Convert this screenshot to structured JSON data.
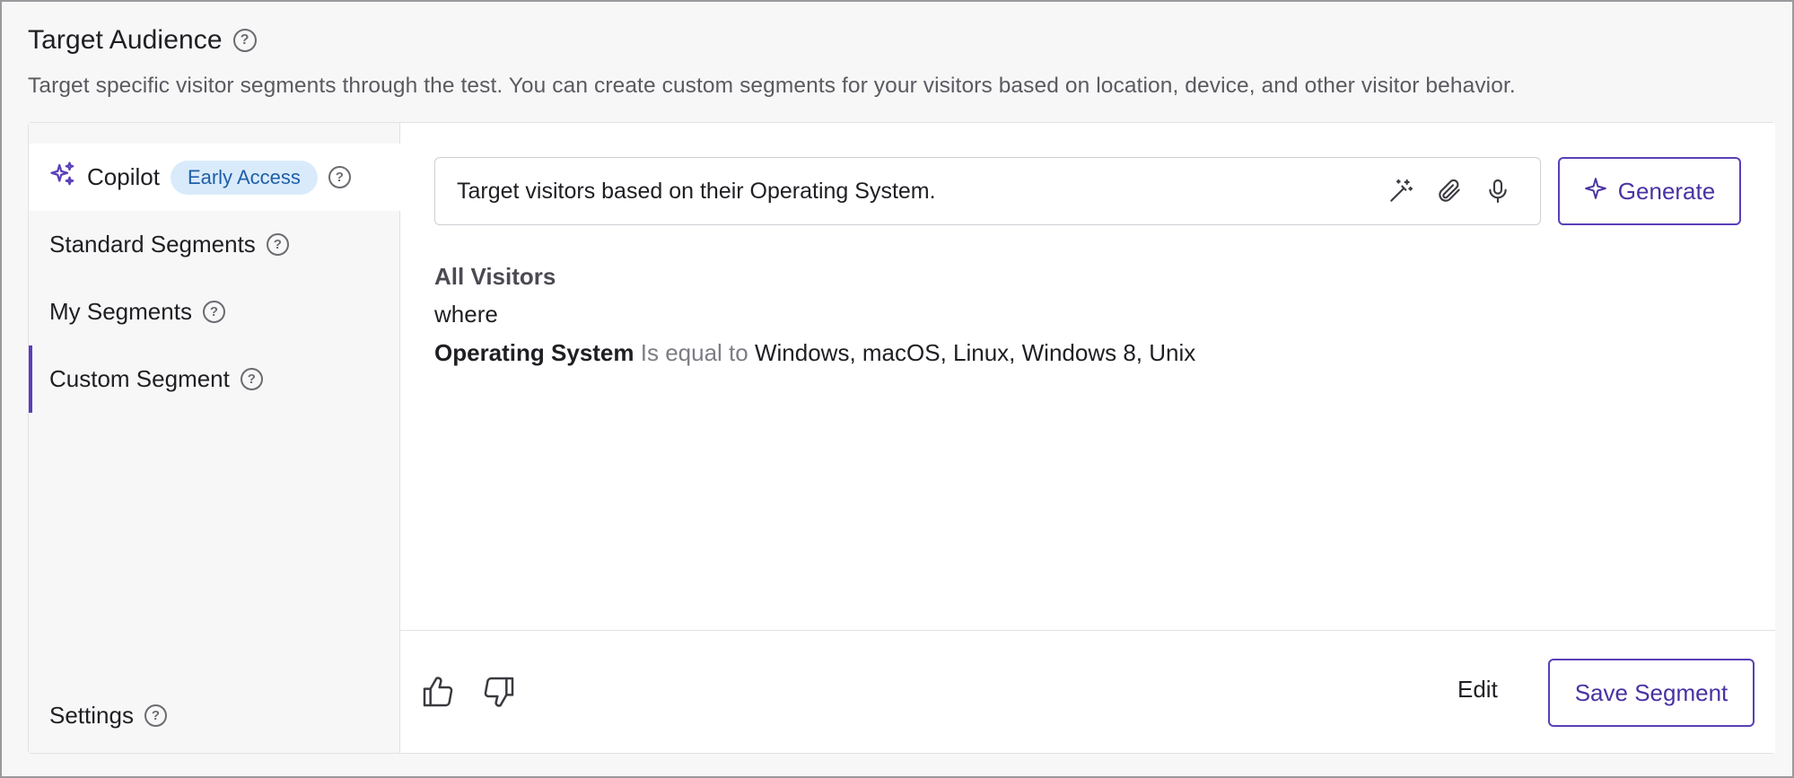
{
  "header": {
    "title": "Target Audience",
    "subtitle": "Target specific visitor segments through the test. You can create custom segments for your visitors based on location, device, and other visitor behavior."
  },
  "sidebar": {
    "items": [
      {
        "label": "Copilot",
        "badge": "Early Access",
        "icon": "sparkles-icon",
        "selected": true
      },
      {
        "label": "Standard Segments"
      },
      {
        "label": "My Segments"
      },
      {
        "label": "Custom Segment",
        "active": true
      },
      {
        "label": "Settings"
      }
    ]
  },
  "prompt": {
    "text": "Target visitors based on their Operating System.",
    "icons": [
      "magic-wand-icon",
      "paperclip-icon",
      "microphone-icon"
    ]
  },
  "generate_label": "Generate",
  "segment": {
    "header": "All Visitors",
    "connector": "where",
    "field": "Operating System",
    "operator": "Is equal to",
    "values": "Windows, macOS, Linux, Windows 8, Unix"
  },
  "footer": {
    "edit_label": "Edit",
    "save_label": "Save Segment"
  },
  "colors": {
    "accent": "#5a3fb8",
    "badge_bg": "#d9ebfb",
    "badge_text": "#1f5ea8"
  }
}
